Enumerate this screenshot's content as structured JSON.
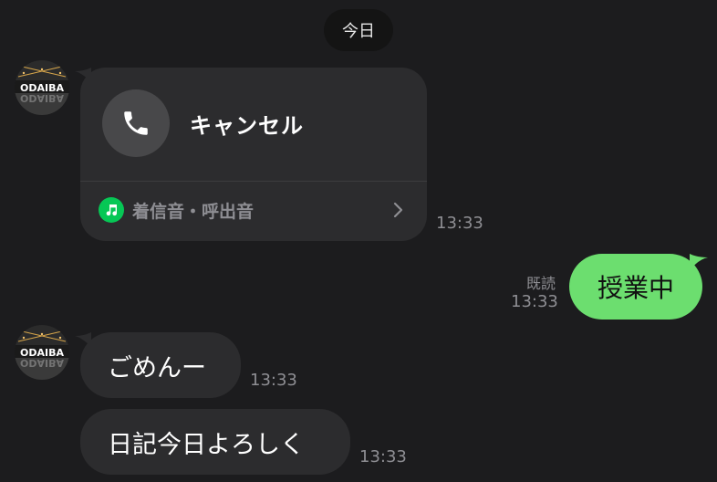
{
  "date_separator": "今日",
  "messages": {
    "call": {
      "title": "キャンセル",
      "ringtone_label": "着信音・呼出音",
      "time": "13:33"
    },
    "outgoing": {
      "text": "授業中",
      "read_label": "既読",
      "time": "13:33"
    },
    "incoming_1": {
      "text": "ごめんー",
      "time": "13:33"
    },
    "incoming_2": {
      "text": "日記今日よろしく",
      "time": "13:33"
    }
  },
  "avatar": {
    "logo_text": "ODAIBA"
  },
  "colors": {
    "background": "#1c1c1e",
    "incoming_bubble": "#2c2c2e",
    "outgoing_bubble": "#6cde6f",
    "line_green": "#06c755"
  },
  "icons": {
    "call": "phone-icon",
    "ringtone": "music-note-icon",
    "open": "chevron-right-icon"
  }
}
